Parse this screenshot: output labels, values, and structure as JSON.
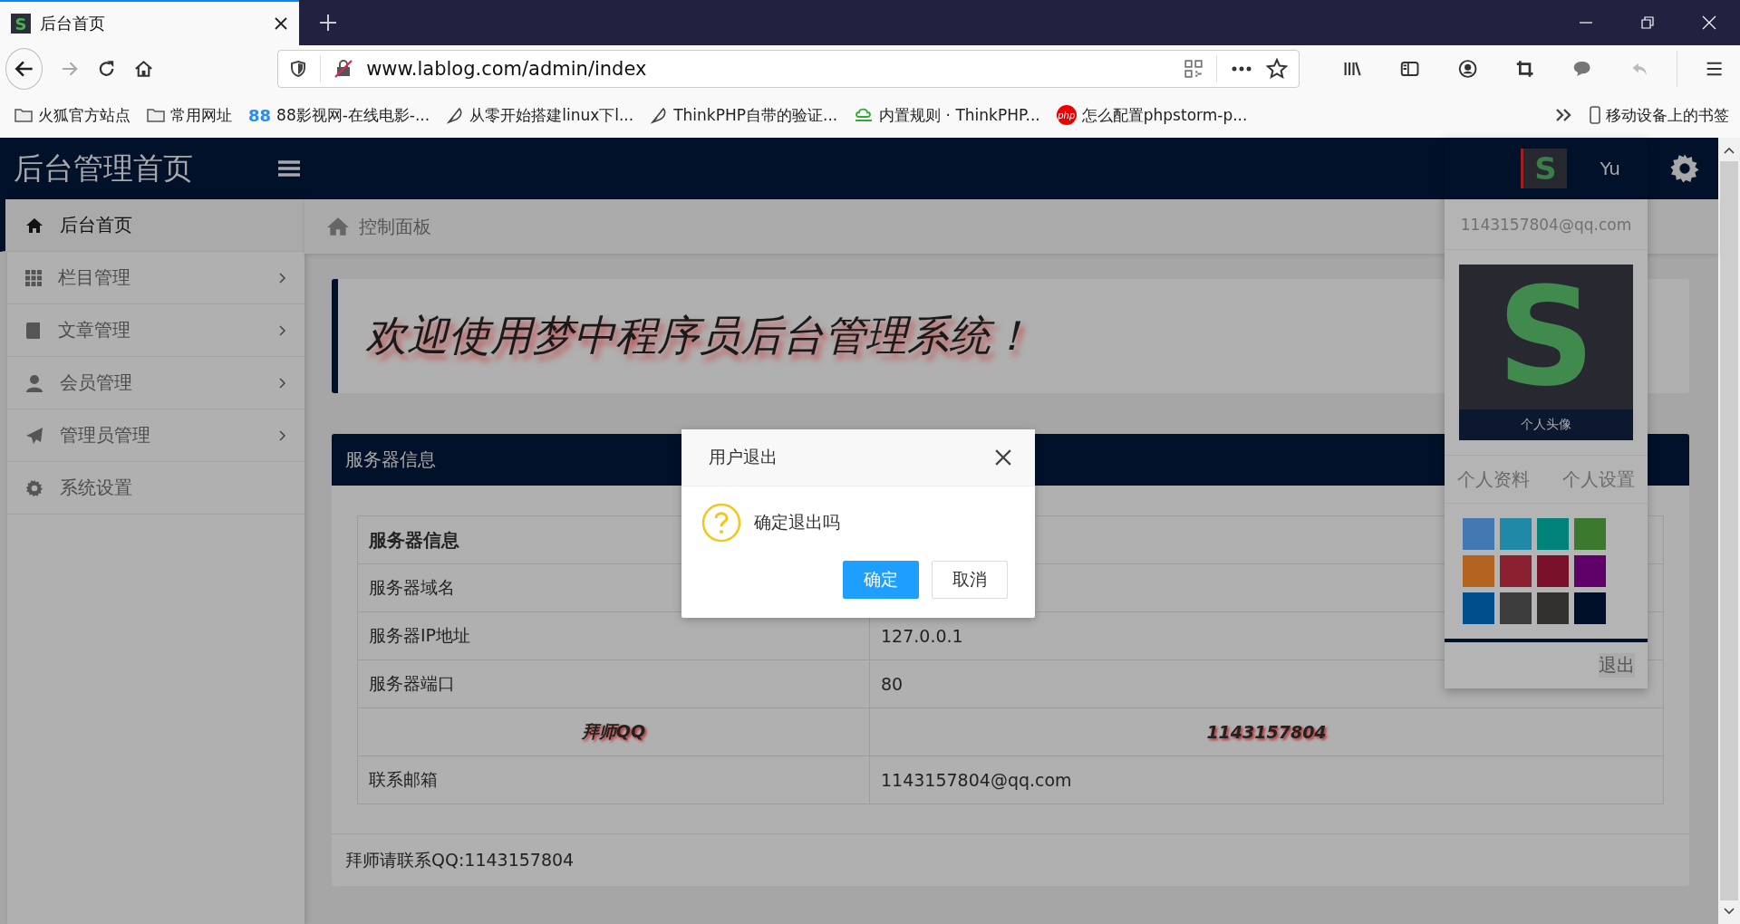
{
  "browser": {
    "tab": {
      "title": "后台首页",
      "favicon": "S"
    },
    "url": "www.lablog.com/admin/index",
    "bookmarks": [
      {
        "kind": "folder",
        "label": "火狐官方站点"
      },
      {
        "kind": "folder",
        "label": "常用网址"
      },
      {
        "kind": "badge",
        "badge": "88",
        "label": "88影视网-在线电影-..."
      },
      {
        "kind": "feather",
        "label": "从零开始搭建linux下l..."
      },
      {
        "kind": "feather",
        "label": "ThinkPHP自带的验证..."
      },
      {
        "kind": "cloud",
        "label": "内置规则 · ThinkPHP..."
      },
      {
        "kind": "php",
        "badge": "php",
        "label": "怎么配置phpstorm-p..."
      }
    ],
    "mobile_bookmarks": "移动设备上的书签"
  },
  "header": {
    "title": "后台管理首页",
    "user": {
      "avatar": "S",
      "name": "Yu"
    }
  },
  "sidebar": {
    "items": [
      {
        "kind": "home",
        "label": "后台首页",
        "selected": true,
        "expandable": false
      },
      {
        "kind": "grid",
        "label": "栏目管理",
        "selected": false,
        "expandable": true
      },
      {
        "kind": "book",
        "label": "文章管理",
        "selected": false,
        "expandable": true
      },
      {
        "kind": "user",
        "label": "会员管理",
        "selected": false,
        "expandable": true
      },
      {
        "kind": "plane",
        "label": "管理员管理",
        "selected": false,
        "expandable": true
      },
      {
        "kind": "gear",
        "label": "系统设置",
        "selected": false,
        "expandable": false
      }
    ]
  },
  "breadcrumb": "控制面板",
  "welcome": "欢迎使用梦中程序员后台管理系统！",
  "server_panel": {
    "title": "服务器信息",
    "rows": [
      {
        "kind": "heading",
        "label": "服务器信息"
      },
      {
        "kind": "plain",
        "label": "服务器域名"
      },
      {
        "kind": "plain",
        "label": "服务器IP地址",
        "value": "127.0.0.1"
      },
      {
        "kind": "plain",
        "label": "服务器端口",
        "value": "80"
      },
      {
        "kind": "shadow",
        "label": "拜师QQ",
        "value": "1143157804"
      },
      {
        "kind": "plain",
        "label": "联系邮箱",
        "value": "1143157804@qq.com"
      }
    ],
    "footer": "拜师请联系QQ:1143157804"
  },
  "user_menu": {
    "email": "1143157804@qq.com",
    "avatar_letter": "S",
    "avatar_caption": "个人头像",
    "links": [
      "个人资料",
      "个人设置"
    ],
    "themes": [
      {
        "color": "#4379b3"
      },
      {
        "color": "#2089a8"
      },
      {
        "color": "#00817a"
      },
      {
        "color": "#3a792e"
      },
      {
        "color": "#b46420"
      },
      {
        "color": "#8a2030"
      },
      {
        "color": "#78102a"
      },
      {
        "color": "#5e0068"
      },
      {
        "color": "#004f8c"
      },
      {
        "color": "#3c3c3c"
      },
      {
        "color": "#333030"
      },
      {
        "color": "#001028"
      }
    ],
    "logout": "退出"
  },
  "dialog": {
    "title": "用户退出",
    "message": "确定退出吗",
    "buttons": [
      {
        "kind": "primary",
        "label": "确定"
      },
      {
        "kind": "secondary",
        "label": "取消"
      }
    ]
  }
}
